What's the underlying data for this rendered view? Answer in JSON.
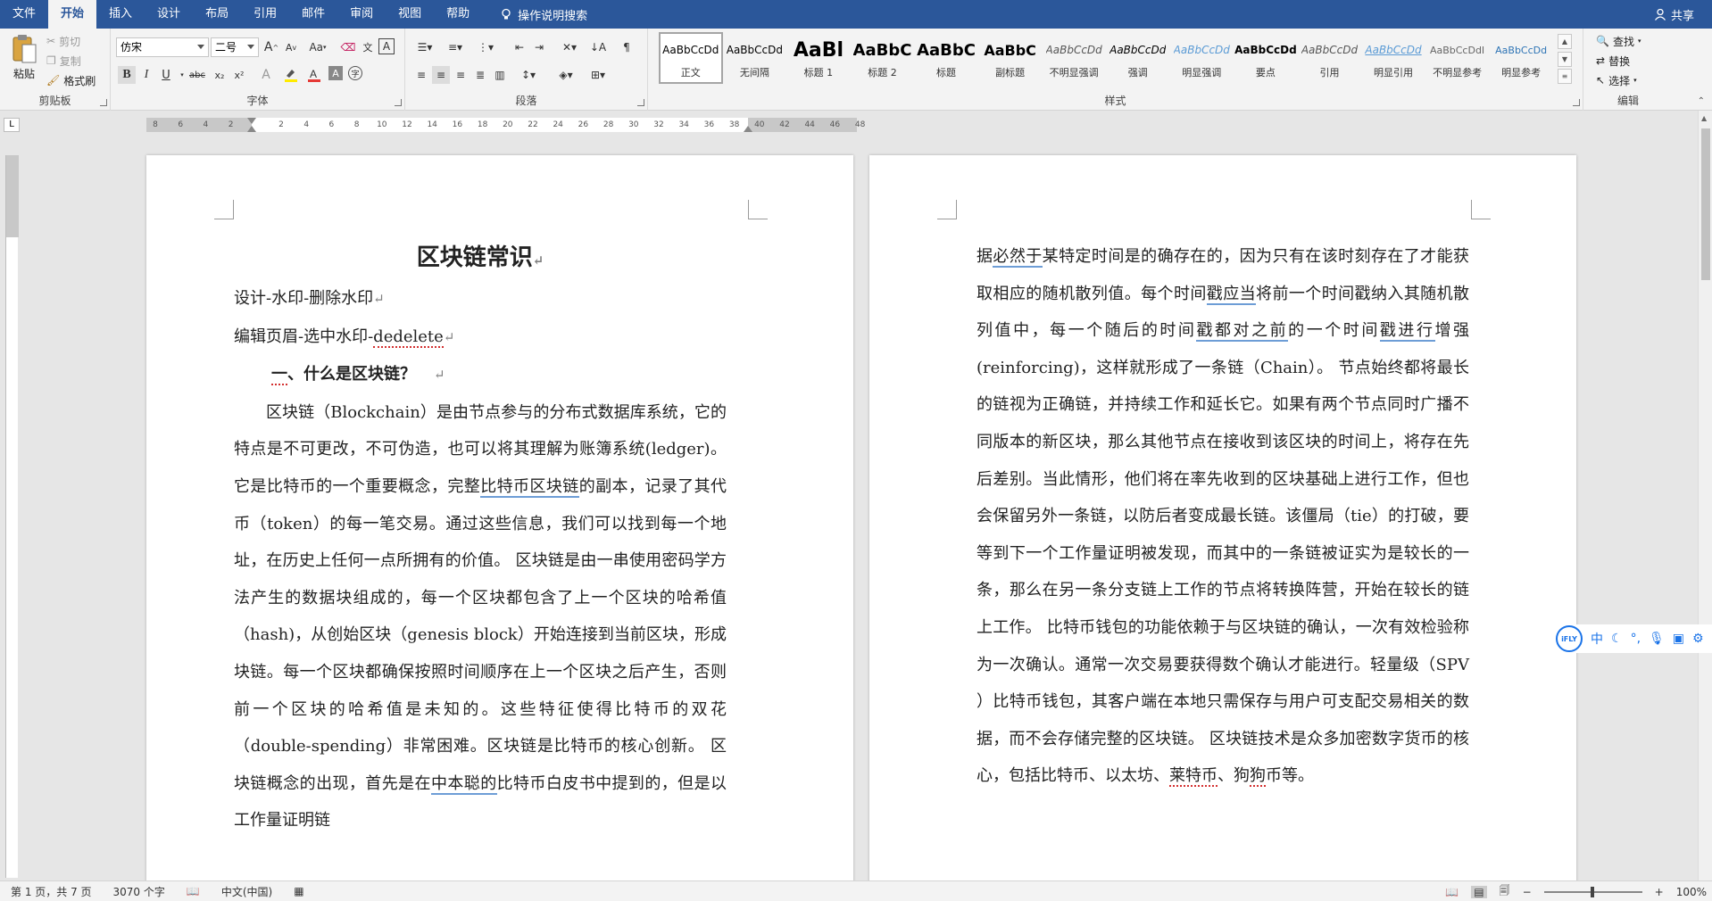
{
  "tabs": [
    {
      "label": "文件",
      "active": false
    },
    {
      "label": "开始",
      "active": true
    },
    {
      "label": "插入",
      "active": false
    },
    {
      "label": "设计",
      "active": false
    },
    {
      "label": "布局",
      "active": false
    },
    {
      "label": "引用",
      "active": false
    },
    {
      "label": "邮件",
      "active": false
    },
    {
      "label": "审阅",
      "active": false
    },
    {
      "label": "视图",
      "active": false
    },
    {
      "label": "帮助",
      "active": false
    }
  ],
  "tell_me": "操作说明搜索",
  "share": "共享",
  "clipboard": {
    "label": "剪贴板",
    "paste": "粘贴",
    "cut": "剪切",
    "copy": "复制",
    "format_painter": "格式刷"
  },
  "font": {
    "label": "字体",
    "font_name": "仿宋",
    "font_size": "二号",
    "grow": "A",
    "shrink": "A",
    "change_case": "Aa",
    "bold": "B",
    "italic": "I",
    "underline": "U",
    "strike": "abc",
    "subscript": "x₂",
    "superscript": "x²"
  },
  "paragraph": {
    "label": "段落"
  },
  "styles": {
    "label": "样式",
    "items": [
      {
        "sample": "AaBbCcDd",
        "name": "正文",
        "selected": true
      },
      {
        "sample": "AaBbCcDd",
        "name": "无间隔",
        "selected": false
      },
      {
        "sample": "AaBl",
        "name": "标题 1",
        "selected": false
      },
      {
        "sample": "AaBbC",
        "name": "标题 2",
        "selected": false
      },
      {
        "sample": "AaBbC",
        "name": "标题",
        "selected": false
      },
      {
        "sample": "AaBbC",
        "name": "副标题",
        "selected": false
      },
      {
        "sample": "AaBbCcDd",
        "name": "不明显强调",
        "selected": false
      },
      {
        "sample": "AaBbCcDd",
        "name": "强调",
        "selected": false
      },
      {
        "sample": "AaBbCcDd",
        "name": "明显强调",
        "selected": false
      },
      {
        "sample": "AaBbCcDd",
        "name": "要点",
        "selected": false
      },
      {
        "sample": "AaBbCcDd",
        "name": "引用",
        "selected": false
      },
      {
        "sample": "AaBbCcDd",
        "name": "明显引用",
        "selected": false
      },
      {
        "sample": "AaBbCcDdI",
        "name": "不明显参考",
        "selected": false
      },
      {
        "sample": "AaBbCcDd",
        "name": "明显参考",
        "selected": false
      }
    ]
  },
  "editing": {
    "label": "编辑",
    "find": "查找",
    "replace": "替换",
    "select": "选择"
  },
  "ruler": {
    "corner": "L",
    "ticks": [
      "8",
      "6",
      "4",
      "2",
      "",
      "2",
      "4",
      "6",
      "8",
      "10",
      "12",
      "14",
      "16",
      "18",
      "20",
      "22",
      "24",
      "26",
      "28",
      "30",
      "32",
      "34",
      "36",
      "38",
      "40",
      "42",
      "44",
      "46",
      "48"
    ]
  },
  "page1": {
    "title": "区块链常识",
    "line1": "设计-水印-删除水印",
    "line2_a": "编辑页眉-选中水印-",
    "line2_b": "dedelete",
    "heading_a": "一",
    "heading_b": "、什么是区块链？",
    "p1_a": "区块链（Blockchain）是由节点参与的分布式数据库系统，它的特点是不可更改，不可伪造，也可以将其理解为账簿系统(ledger)。它是比特币的一个重要概念，完整",
    "p1_b": "比特币区块链",
    "p1_c": "的副本，记录了其代币（token）的每一笔交易。通过这些信息，我们可以找到每一个地址，在历史上任何一点所拥有的价值。  区块链是由一串使用密码学方法产生的数据块组成的，每一个区块都包含了上一个区块的哈希值（hash)，从创始区块（genesis block）开始连接到当前区块，形成块链。每一个区块都确保按照时间顺序在上一个区块之后产生，否则前一个区块的哈希值是未知的。这些特征使得比特币的双花（double-spending）非常困难。区块链是比特币的核心创新。  区块链概念的出现，首先是在",
    "p1_d": "中本聪的",
    "p1_e": "比特币白皮书中提到的，但是以工作量证明链"
  },
  "page2": {
    "p_a": "据",
    "p_b": "必然于",
    "p_c": "某特定时间是的确存在的，因为只有在该时刻存在了才能获取相应的随机散列值。每个时间",
    "p_d": "戳应当",
    "p_e": "将前一个时间戳纳入其随机散列值中，每一个随后的时间",
    "p_f": "戳都对之前",
    "p_g": "的一个时间",
    "p_h": "戳进行",
    "p_i": "增强(reinforcing)，这样就形成了一条链（Chain）。 节点始终都将最长的链视为正确链，并持续工作和延长它。如果有两个节点同时广播不同版本的新区块，那么其他节点在接收到该区块的时间上，将存在先后差别。当此情形，他们将在率先收到的区块基础上进行工作，但也会保留另外一条链，以防后者变成最长链。该僵局（tie）的打破，要等到下一个工作量证明被发现，而其中的一条链被证实为是较长的一条，那么在另一条分支链上工作的节点将转换阵营，开始在较长的链上工作。  比特币钱包的功能依赖于与区块链的确认，一次有效检验称为一次确认。通常一次交易要获得数个确认才能进行。轻量级（SPV ）比特币钱包，其客户端在本地只需保存与用户可支配交易相关的数据，而不会存储完整的区块链。  区块链技术是众多加密数字货币的核心，包括比特币、以太坊、",
    "p_j": "莱特币",
    "p_k": "、狗",
    "p_l": "狗",
    "p_m": "币等。"
  },
  "ime": {
    "logo": "iFLY",
    "mode": "中"
  },
  "status": {
    "page": "第 1 页，共 7 页",
    "words": "3070 个字",
    "language": "中文(中国)",
    "zoom": "100%"
  },
  "colors": {
    "brand": "#2b579a",
    "ribbon": "#f3f3f3",
    "ime_blue": "#1a73e8"
  }
}
